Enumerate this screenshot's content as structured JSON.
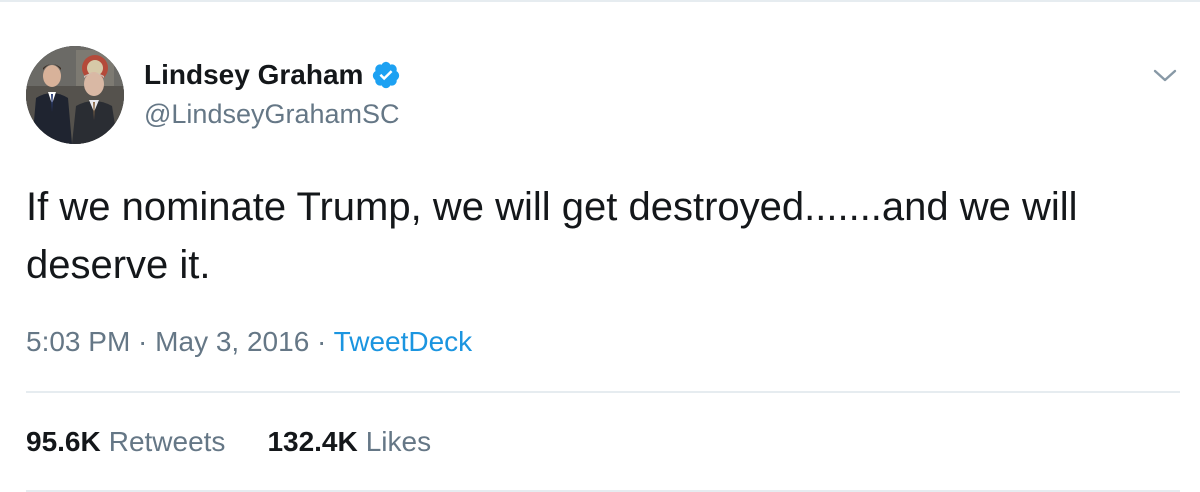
{
  "tweet": {
    "author": {
      "display_name": "Lindsey Graham",
      "handle": "@LindseyGrahamSC",
      "verified": true,
      "avatar_icon": "profile-photo"
    },
    "text": "If we nominate Trump, we will get destroyed.......and we will deserve it.",
    "meta": {
      "time": "5:03 PM",
      "separator": " · ",
      "date": "May 3, 2016",
      "source": "TweetDeck"
    },
    "stats": {
      "retweets_count": "95.6K",
      "retweets_label": "Retweets",
      "likes_count": "132.4K",
      "likes_label": "Likes"
    },
    "menu_icon": "chevron-down-icon"
  },
  "colors": {
    "text_primary": "#14171a",
    "text_secondary": "#657786",
    "link": "#1b95e0",
    "verified_badge": "#1da1f2",
    "divider": "#e6ecf0"
  }
}
